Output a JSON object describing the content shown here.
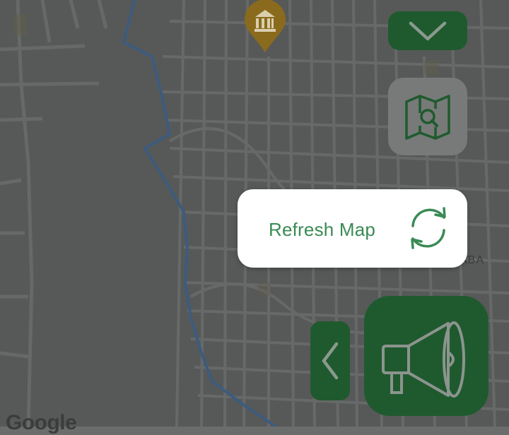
{
  "map": {
    "place_label_partial": "ABA",
    "attribution": "Google",
    "poi_icon": "museum-icon"
  },
  "controls": {
    "collapse_icon": "chevron-down-icon",
    "map_search_icon": "map-search-icon",
    "refresh": {
      "label": "Refresh Map",
      "icon": "refresh-icon"
    },
    "back_icon": "chevron-left-icon",
    "announce_icon": "megaphone-icon"
  },
  "colors": {
    "primary_green": "#1f5a2e",
    "accent_green": "#3a8a55",
    "river_blue": "#4a6f9a",
    "poi_gold": "#8a6a1c"
  }
}
